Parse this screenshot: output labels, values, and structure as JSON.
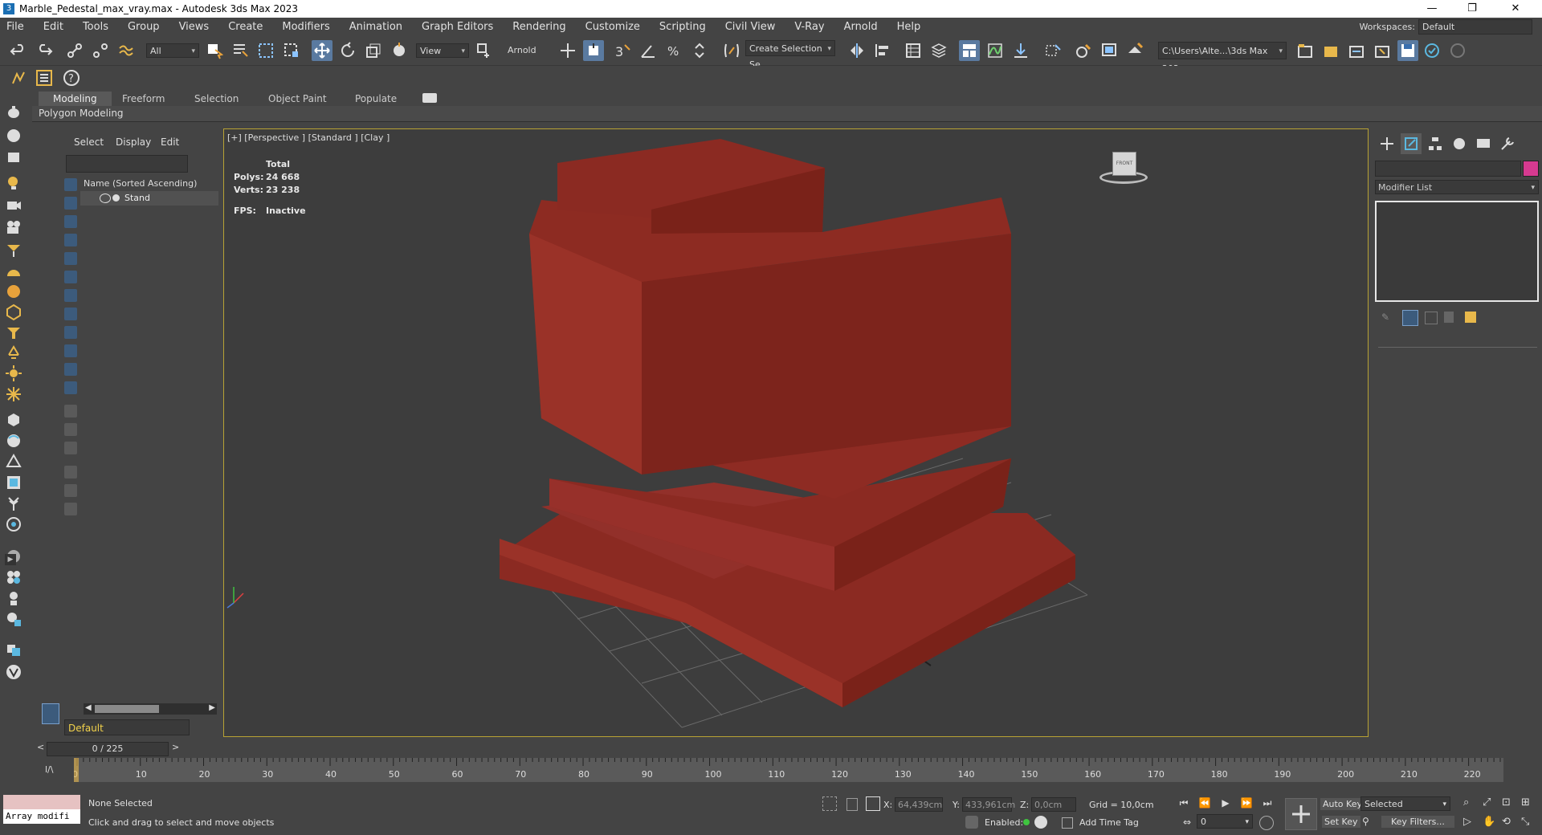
{
  "window": {
    "title": "Marble_Pedestal_max_vray.max - Autodesk 3ds Max 2023",
    "minimize": "—",
    "maximize": "❐",
    "close": "✕"
  },
  "menu": {
    "items": [
      "File",
      "Edit",
      "Tools",
      "Group",
      "Views",
      "Create",
      "Modifiers",
      "Animation",
      "Graph Editors",
      "Rendering",
      "Customize",
      "Scripting",
      "Civil View",
      "V-Ray",
      "Arnold",
      "Help"
    ],
    "workspace_label": "Workspaces:",
    "workspace_value": "Default"
  },
  "toolbar": {
    "selection_filter": "All",
    "ref_coord": "View",
    "arnold_label": "Arnold",
    "named_selection": "Create Selection Se",
    "project_path": "C:\\Users\\Alte...\\3ds Max 202"
  },
  "ribbon": {
    "tabs": [
      "Modeling",
      "Freeform",
      "Selection",
      "Object Paint",
      "Populate"
    ],
    "active_tab": "Modeling",
    "sub_label": "Polygon Modeling"
  },
  "scene_explorer": {
    "tabs": [
      "Select",
      "Display",
      "Edit"
    ],
    "column_header": "Name (Sorted Ascending)",
    "items": [
      {
        "name": "Stand"
      }
    ],
    "layer": "Default"
  },
  "viewport": {
    "label": "[+] [Perspective ] [Standard ] [Clay ]",
    "stats": {
      "header": "Total",
      "polys_label": "Polys:",
      "polys": "24 668",
      "verts_label": "Verts:",
      "verts": "23 238",
      "fps_label": "FPS:",
      "fps": "Inactive"
    },
    "object_color": "#8b2a22",
    "viewcube_label": "FRONT"
  },
  "command_panel": {
    "modifier_list": "Modifier List",
    "object_color": "#d63a90"
  },
  "timeline": {
    "slider": "0 / 225",
    "ticks": [
      0,
      10,
      20,
      30,
      40,
      50,
      60,
      70,
      80,
      90,
      100,
      110,
      120,
      130,
      140,
      150,
      160,
      170,
      180,
      190,
      200,
      210,
      220
    ]
  },
  "status": {
    "maxscript": "Array modifi",
    "selection": "None Selected",
    "prompt": "Click and drag to select and move objects",
    "x_label": "X:",
    "x": "64,439cm",
    "y_label": "Y:",
    "y": "433,961cm",
    "z_label": "Z:",
    "z": "0,0cm",
    "grid": "Grid = 10,0cm",
    "enabled_label": "Enabled:",
    "add_time_tag": "Add Time Tag",
    "auto_key": "Auto Key",
    "set_key": "Set Key",
    "selected": "Selected",
    "key_filters": "Key Filters...",
    "frame": "0"
  }
}
